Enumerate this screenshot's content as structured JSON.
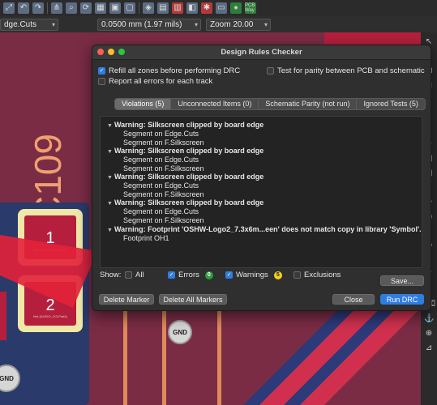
{
  "toolbar": {
    "icons": [
      "zoom-fit-icon",
      "undo-icon",
      "redo-icon",
      "net-navigator-icon",
      "search-icon",
      "refresh-icon",
      "grid-icon",
      "lock-icon",
      "unlock-icon",
      "route-icon",
      "board-setup-icon",
      "netlist-icon",
      "footprint-editor-icon",
      "drc-icon",
      "scripting-icon",
      "library-icon",
      "pcbway-icon"
    ],
    "pcbway_label": "PCB Way"
  },
  "subbar": {
    "layer": "dge.Cuts",
    "grid": "0.0500 mm (1.97 mils)",
    "zoom": "Zoom 20.00"
  },
  "pcb": {
    "ref_label": "C109",
    "pad1": "1",
    "pad2": "2",
    "pad_net": "Net-(AUDIO_IX3-Pad4)",
    "pad_net2": "Net-(AUDIO_IX3-Pad4)",
    "gnd1": "GND",
    "gnd2": "GND"
  },
  "dialog": {
    "title": "Design Rules Checker",
    "refill_zones": {
      "label": "Refill all zones before performing DRC",
      "checked": true
    },
    "report_all": {
      "label": "Report all errors for each track",
      "checked": false
    },
    "test_parity": {
      "label": "Test for parity between PCB and schematic",
      "checked": false
    },
    "tabs": [
      {
        "label": "Violations (5)",
        "active": true
      },
      {
        "label": "Unconnected Items (0)",
        "active": false
      },
      {
        "label": "Schematic Parity (not run)",
        "active": false
      },
      {
        "label": "Ignored Tests (5)",
        "active": false
      }
    ],
    "violations": [
      {
        "title": "Warning: Silkscreen clipped by board edge",
        "items": [
          "Segment on Edge.Cuts",
          "Segment on F.Silkscreen"
        ]
      },
      {
        "title": "Warning: Silkscreen clipped by board edge",
        "items": [
          "Segment on Edge.Cuts",
          "Segment on F.Silkscreen"
        ]
      },
      {
        "title": "Warning: Silkscreen clipped by board edge",
        "items": [
          "Segment on Edge.Cuts",
          "Segment on F.Silkscreen"
        ]
      },
      {
        "title": "Warning: Silkscreen clipped by board edge",
        "items": [
          "Segment on Edge.Cuts",
          "Segment on F.Silkscreen"
        ]
      },
      {
        "title": "Warning: Footprint 'OSHW-Logo2_7.3x6m...een' does not match copy in library 'Symbol'.",
        "items": [
          "Footprint OH1"
        ]
      }
    ],
    "show_label": "Show:",
    "filters": {
      "all": {
        "label": "All",
        "checked": false
      },
      "errors": {
        "label": "Errors",
        "checked": true,
        "count": "0",
        "color": "#2e9d3a"
      },
      "warnings": {
        "label": "Warnings",
        "checked": true,
        "count": "5",
        "color": "#f2d21b"
      },
      "exclusions": {
        "label": "Exclusions",
        "checked": false
      }
    },
    "buttons": {
      "save": "Save...",
      "delete_marker": "Delete Marker",
      "delete_all": "Delete All Markers",
      "close": "Close",
      "run": "Run DRC"
    }
  },
  "colors": {
    "board": "#7a2c45",
    "copper_pad": "#b51f3d",
    "silk": "#f0a070",
    "accent": "#2f7de1"
  }
}
